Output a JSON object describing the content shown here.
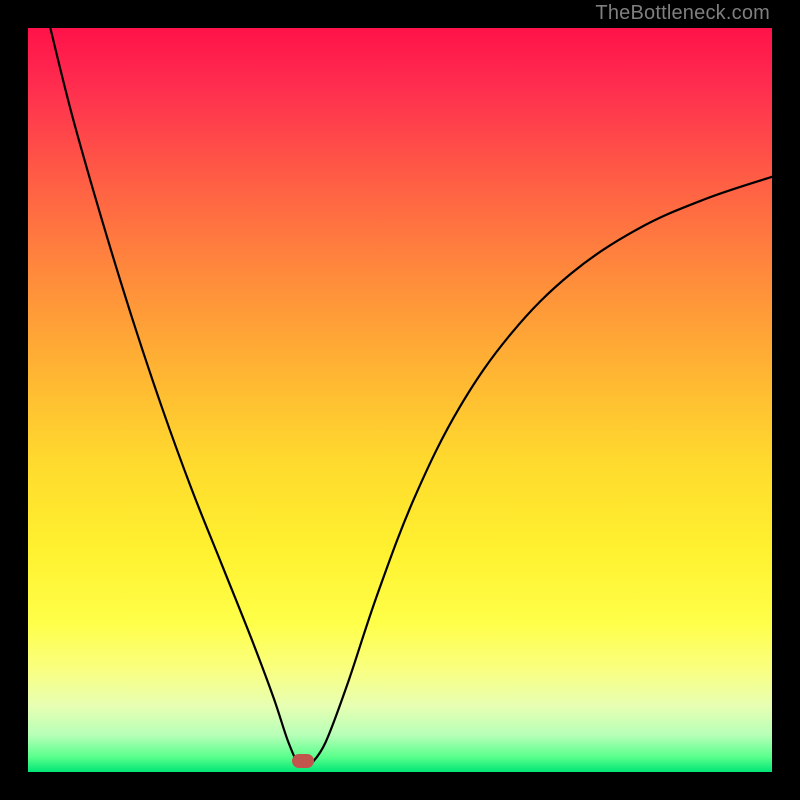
{
  "watermark": "TheBottleneck.com",
  "colors": {
    "frame": "#000000",
    "watermark": "#7f7f7f",
    "curve": "#000000",
    "marker": "#c1554d",
    "gradient_stops": [
      "#ff1249",
      "#ff2e4f",
      "#ff5c45",
      "#ff8a3c",
      "#ffb433",
      "#ffd92e",
      "#fff12f",
      "#ffff49",
      "#faff7e",
      "#e8ffb2",
      "#b8ffb8",
      "#59ff8c",
      "#00e676"
    ]
  },
  "chart_data": {
    "type": "line",
    "title": "",
    "xlabel": "",
    "ylabel": "",
    "xlim": [
      0,
      100
    ],
    "ylim": [
      0,
      100
    ],
    "grid": false,
    "legend": false,
    "marker": {
      "x": 37,
      "y": 1.5
    },
    "series": [
      {
        "name": "left-branch",
        "x": [
          3,
          6,
          10,
          14,
          18,
          22,
          26,
          30,
          33,
          35,
          36.5,
          38
        ],
        "y": [
          100,
          88,
          74,
          61,
          49,
          38,
          28,
          18,
          10,
          4,
          1,
          1
        ]
      },
      {
        "name": "right-branch",
        "x": [
          38,
          40,
          43,
          47,
          52,
          58,
          65,
          73,
          82,
          91,
          100
        ],
        "y": [
          1,
          4,
          12,
          24,
          37,
          49,
          59,
          67,
          73,
          77,
          80
        ]
      }
    ]
  }
}
